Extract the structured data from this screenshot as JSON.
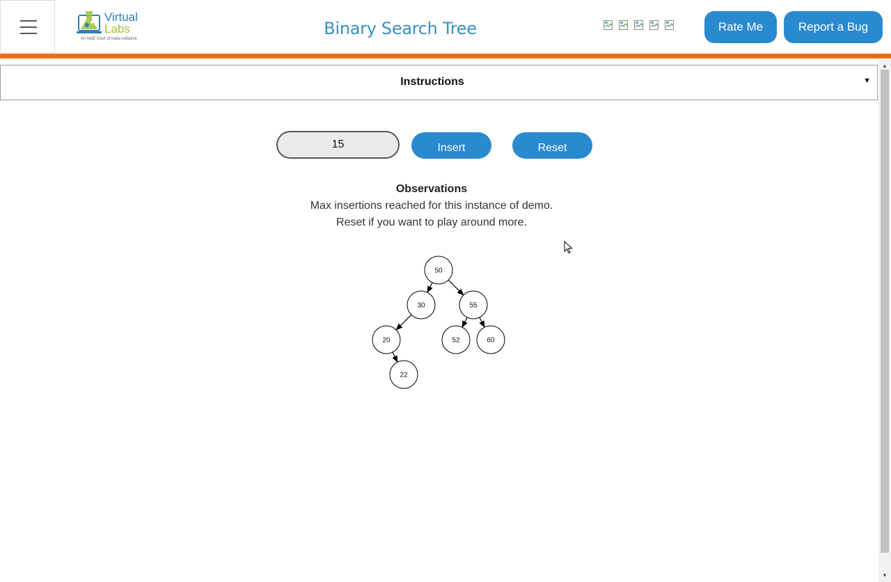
{
  "header": {
    "logo": {
      "line1": "Virtual",
      "line2": "Labs",
      "tagline": "An MoE Govt of India Initiative"
    },
    "title": "Binary Search Tree",
    "rate_label": "Rate Me",
    "bug_label": "Report a Bug",
    "accent_color": "#ef6c13",
    "button_color": "#2a8ad0"
  },
  "instructions": {
    "label": "Instructions",
    "caret": "▼"
  },
  "controls": {
    "input_value": "15",
    "insert_label": "Insert",
    "reset_label": "Reset"
  },
  "observations": {
    "heading": "Observations",
    "line1": "Max insertions reached for this instance of demo.",
    "line2": "Reset if you want to play around more."
  },
  "tree": {
    "nodes": [
      {
        "value": "50",
        "parent": null
      },
      {
        "value": "30",
        "parent": "50"
      },
      {
        "value": "55",
        "parent": "50"
      },
      {
        "value": "20",
        "parent": "30"
      },
      {
        "value": "52",
        "parent": "55"
      },
      {
        "value": "60",
        "parent": "55"
      },
      {
        "value": "22",
        "parent": "20"
      }
    ]
  }
}
